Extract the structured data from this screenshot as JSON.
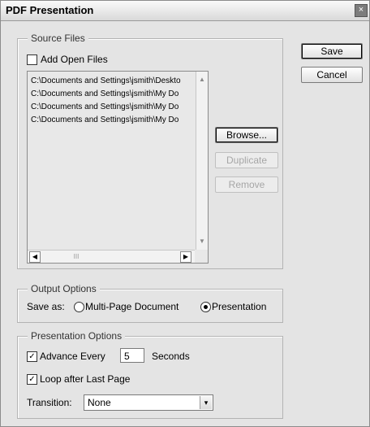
{
  "window": {
    "title": "PDF Presentation",
    "close_glyph": "×"
  },
  "source_files": {
    "legend": "Source Files",
    "add_open_files_label": "Add Open Files",
    "add_open_files_checked": false,
    "files": [
      "C:\\Documents and Settings\\jsmith\\Deskto",
      "C:\\Documents and Settings\\jsmith\\My Do",
      "C:\\Documents and Settings\\jsmith\\My Do",
      "C:\\Documents and Settings\\jsmith\\My Do"
    ],
    "buttons": {
      "browse": "Browse...",
      "duplicate": "Duplicate",
      "remove": "Remove"
    },
    "scroll_glyphs": {
      "up": "▲",
      "down": "▼",
      "left": "◀",
      "right": "▶",
      "thumb": "III"
    }
  },
  "actions": {
    "save": "Save",
    "cancel": "Cancel"
  },
  "output_options": {
    "legend": "Output Options",
    "save_as_label": "Save as:",
    "option_multipage": "Multi-Page Document",
    "option_presentation": "Presentation",
    "selected": "Presentation"
  },
  "presentation_options": {
    "legend": "Presentation Options",
    "advance_label": "Advance Every",
    "advance_checked": true,
    "advance_seconds": "5",
    "seconds_label": "Seconds",
    "loop_label": "Loop after Last Page",
    "loop_checked": true,
    "transition_label": "Transition:",
    "transition_value": "None",
    "check_glyph": "✓",
    "dropdown_glyph": "▾"
  }
}
